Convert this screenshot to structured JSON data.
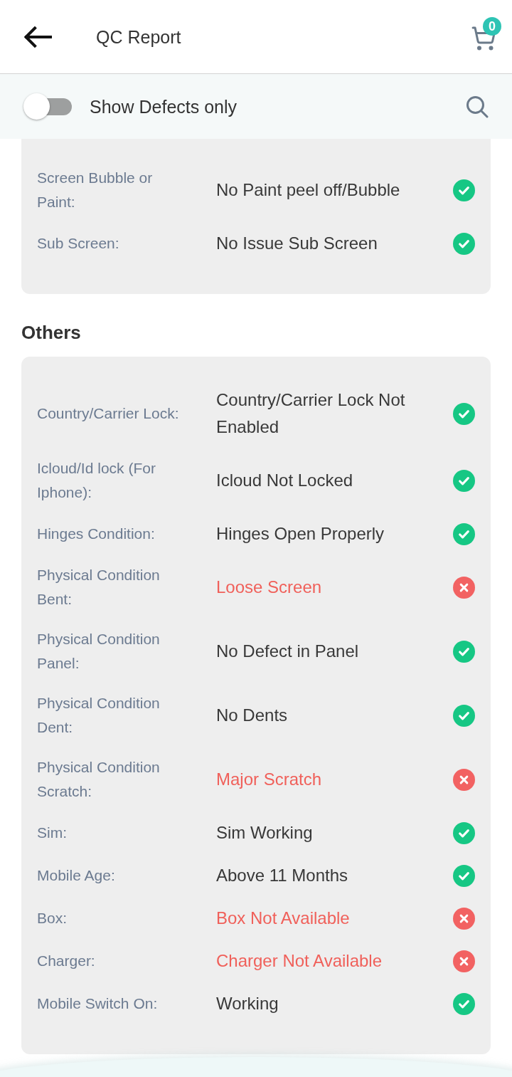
{
  "header": {
    "title": "QC Report",
    "cart_count": "0"
  },
  "filter": {
    "label": "Show Defects only",
    "on": false
  },
  "sections": [
    {
      "rows": [
        {
          "label": "Screen Bubble or Paint:",
          "value": "No Paint peel off/Bubble",
          "defect": false
        },
        {
          "label": "Sub Screen:",
          "value": "No Issue Sub Screen",
          "defect": false
        }
      ]
    },
    {
      "title": "Others",
      "rows": [
        {
          "label": "Country/Carrier Lock:",
          "value": "Country/Carrier Lock Not Enabled",
          "defect": false
        },
        {
          "label": "Icloud/Id lock (For Iphone):",
          "value": "Icloud Not Locked",
          "defect": false
        },
        {
          "label": "Hinges Condition:",
          "value": "Hinges Open Properly",
          "defect": false
        },
        {
          "label": "Physical Condition Bent:",
          "value": "Loose Screen",
          "defect": true
        },
        {
          "label": "Physical Condition Panel:",
          "value": "No Defect in Panel",
          "defect": false
        },
        {
          "label": "Physical Condition Dent:",
          "value": "No Dents",
          "defect": false
        },
        {
          "label": "Physical Condition Scratch:",
          "value": "Major Scratch",
          "defect": true
        },
        {
          "label": "Sim:",
          "value": "Sim Working",
          "defect": false
        },
        {
          "label": "Mobile Age:",
          "value": "Above 11 Months",
          "defect": false
        },
        {
          "label": "Box:",
          "value": "Box Not Available",
          "defect": true
        },
        {
          "label": "Charger:",
          "value": "Charger Not Available",
          "defect": true
        },
        {
          "label": "Mobile Switch On:",
          "value": "Working",
          "defect": false
        }
      ]
    }
  ]
}
